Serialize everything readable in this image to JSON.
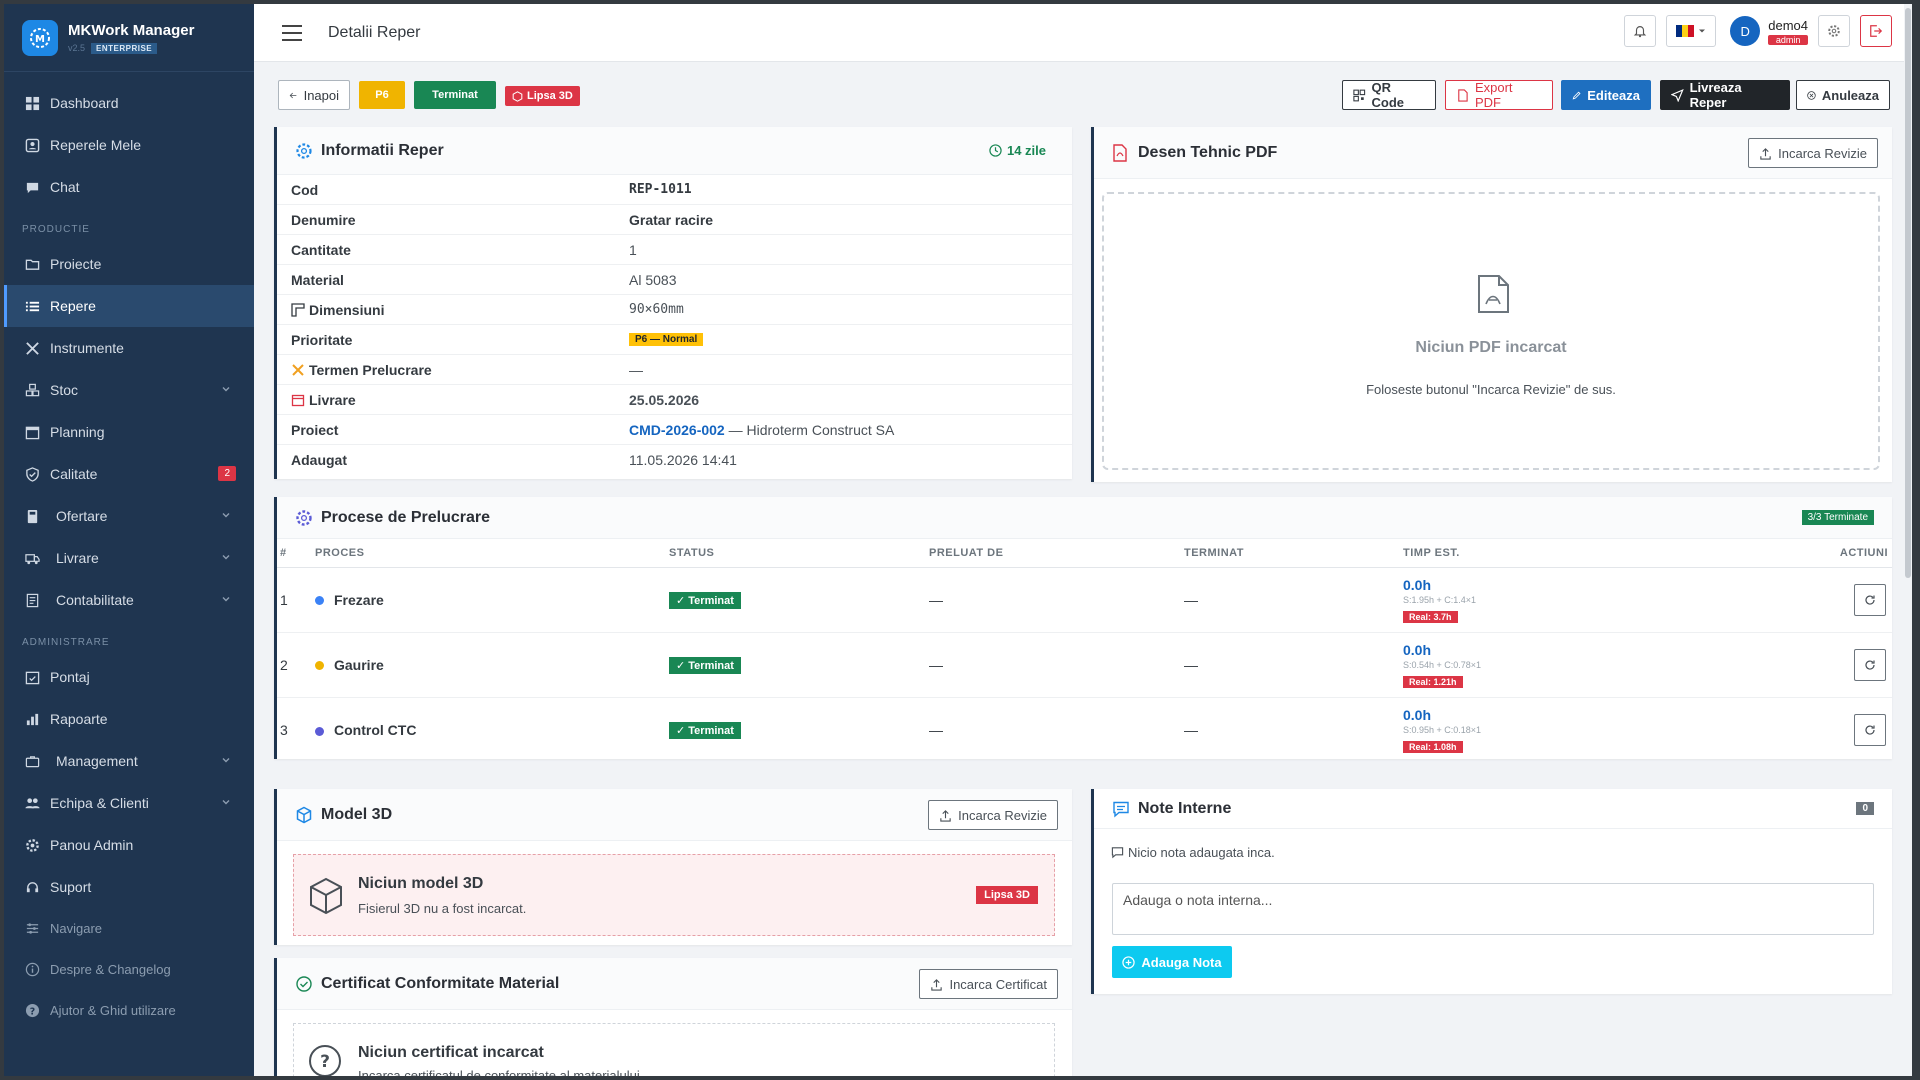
{
  "brand": {
    "name": "MKWork Manager",
    "version": "v2.5",
    "edition": "ENTERPRISE"
  },
  "nav": {
    "dashboard": "Dashboard",
    "my_parts": "Reperele Mele",
    "chat": "Chat",
    "section_production": "PRODUCTIE",
    "projects": "Proiecte",
    "parts": "Repere",
    "tools": "Instrumente",
    "stock": "Stoc",
    "planning": "Planning",
    "quality": "Calitate",
    "quality_badge": "2",
    "offers": "Ofertare",
    "delivery": "Livrare",
    "accounting": "Contabilitate",
    "section_admin": "ADMINISTRARE",
    "timesheet": "Pontaj",
    "reports": "Rapoarte",
    "management": "Management",
    "team": "Echipa & Clienti",
    "admin_panel": "Panou Admin",
    "support": "Suport",
    "navigation": "Navigare",
    "about": "Despre & Changelog",
    "help": "Ajutor & Ghid utilizare"
  },
  "topbar": {
    "title": "Detalii Reper",
    "user_name": "demo4",
    "user_role": "admin",
    "avatar_letter": "D"
  },
  "toolbar": {
    "back": "Inapoi",
    "priority_tag": "P6",
    "status_tag": "Terminat",
    "missing3d_tag": "Lipsa 3D",
    "qr": "QR Code",
    "export_pdf": "Export PDF",
    "edit": "Editeaza",
    "deliver": "Livreaza Reper",
    "cancel": "Anuleaza"
  },
  "info": {
    "title": "Informatii Reper",
    "days": "14 zile",
    "rows": [
      {
        "label": "Cod",
        "value": "REP-1011"
      },
      {
        "label": "Denumire",
        "value": "Gratar racire"
      },
      {
        "label": "Cantitate",
        "value": "1"
      },
      {
        "label": "Material",
        "value": "Al 5083"
      },
      {
        "label": "Dimensiuni",
        "value": "90×60mm"
      },
      {
        "label": "Prioritate",
        "value": "P6 — Normal"
      },
      {
        "label": "Termen Prelucrare",
        "value": "—"
      },
      {
        "label": "Livrare",
        "value": "25.05.2026"
      },
      {
        "label": "Proiect",
        "value": "CMD-2026-002",
        "extra": "— Hidroterm Construct SA"
      },
      {
        "label": "Adaugat",
        "value": "11.05.2026 14:41"
      }
    ]
  },
  "pdf": {
    "title": "Desen Tehnic PDF",
    "upload": "Incarca Revizie",
    "empty_title": "Niciun PDF incarcat",
    "empty_hint": "Foloseste butonul \"Incarca Revizie\" de sus."
  },
  "processes": {
    "title": "Procese de Prelucrare",
    "done_badge": "3/3 Terminate",
    "columns": [
      "#",
      "PROCES",
      "STATUS",
      "PRELUAT DE",
      "TERMINAT",
      "TIMP EST.",
      "ACTIUNI"
    ],
    "rows": [
      {
        "num": "1",
        "name": "Frezare",
        "dot": "#3b82f6",
        "status": "✓ Terminat",
        "taken": "—",
        "finished": "—",
        "time": "0.0h",
        "time_sub": "S:1.95h + C:1.4×1",
        "real": "Real: 3.7h"
      },
      {
        "num": "2",
        "name": "Gaurire",
        "dot": "#f0b400",
        "status": "✓ Terminat",
        "taken": "—",
        "finished": "—",
        "time": "0.0h",
        "time_sub": "S:0.54h + C:0.78×1",
        "real": "Real: 1.21h"
      },
      {
        "num": "3",
        "name": "Control CTC",
        "dot": "#5b5bd6",
        "status": "✓ Terminat",
        "taken": "—",
        "finished": "—",
        "time": "0.0h",
        "time_sub": "S:0.95h + C:0.18×1",
        "real": "Real: 1.08h"
      }
    ]
  },
  "model3d": {
    "title": "Model 3D",
    "upload": "Incarca Revizie",
    "empty_title": "Niciun model 3D",
    "empty_hint": "Fisierul 3D nu a fost incarcat.",
    "badge": "Lipsa 3D"
  },
  "cert": {
    "title": "Certificat Conformitate Material",
    "upload": "Incarca Certificat",
    "empty_title": "Niciun certificat incarcat",
    "empty_hint": "Incarca certificatul de conformitate al materialului"
  },
  "notes": {
    "title": "Note Interne",
    "count": "0",
    "empty": "Nicio nota adaugata inca.",
    "placeholder": "Adauga o nota interna...",
    "add": "Adauga Nota"
  },
  "colors": {
    "sidebar": "#1f3550",
    "primary": "#1565c0",
    "success": "#198754",
    "danger": "#dc3545",
    "warning": "#f0b400",
    "info": "#0dcaf0"
  }
}
